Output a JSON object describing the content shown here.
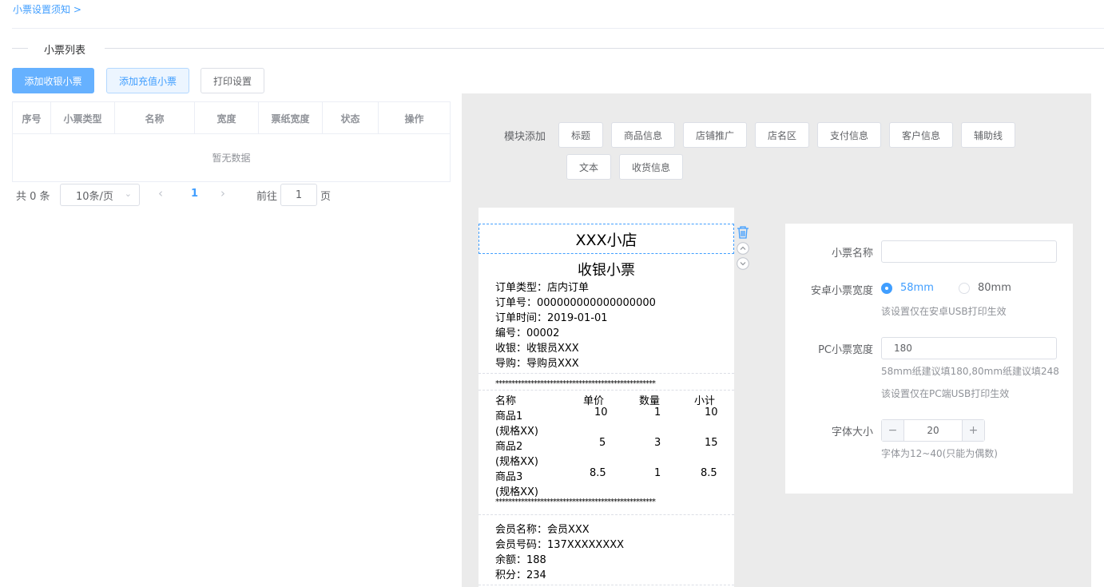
{
  "breadcrumb": "小票设置须知 >",
  "section_title": "小票列表",
  "buttons": {
    "add_cash": "添加收银小票",
    "add_recharge": "添加充值小票",
    "print_settings": "打印设置"
  },
  "table": {
    "columns": [
      "序号",
      "小票类型",
      "名称",
      "宽度",
      "票纸宽度",
      "状态",
      "操作"
    ],
    "empty_text": "暂无数据"
  },
  "pagination": {
    "total": "共 0 条",
    "page_size": "10条/页",
    "current_page": "1",
    "goto_label": "前往",
    "goto_value": "1",
    "page_suffix": "页"
  },
  "modules": {
    "label": "模块添加",
    "items": [
      "标题",
      "商品信息",
      "店铺推广",
      "店名区",
      "支付信息",
      "客户信息",
      "辅助线",
      "文本",
      "收货信息"
    ]
  },
  "receipt": {
    "shop_name": "XXX小店",
    "title": "收银小票",
    "info_lines": [
      "订单类型：店内订单",
      "订单号：000000000000000000",
      "订单时间：2019-01-01",
      "编号：00002",
      "收银：收银员XXX",
      "导购：导购员XXX"
    ],
    "stars": "**************************************************",
    "goods_header": [
      "名称",
      "单价",
      "数量",
      "小计"
    ],
    "goods": [
      {
        "name": "商品1",
        "spec": "(规格XX)",
        "price": "10",
        "qty": "1",
        "subtotal": "10"
      },
      {
        "name": "商品2",
        "spec": "(规格XX)",
        "price": "5",
        "qty": "3",
        "subtotal": "15"
      },
      {
        "name": "商品3",
        "spec": "(规格XX)",
        "price": "8.5",
        "qty": "1",
        "subtotal": "8.5"
      }
    ],
    "member_lines": [
      "会员名称：会员XXX",
      "会员号码：137XXXXXXXX",
      "余额：188",
      "积分：234"
    ]
  },
  "settings": {
    "name_label": "小票名称",
    "name_value": "",
    "android_width_label": "安卓小票宽度",
    "android_options": [
      "58mm",
      "80mm"
    ],
    "android_selected": "58mm",
    "android_hint": "该设置仅在安卓USB打印生效",
    "pc_width_label": "PC小票宽度",
    "pc_width_value": "180",
    "pc_hint1": "58mm纸建议填180,80mm纸建议填248",
    "pc_hint2": "该设置仅在PC端USB打印生效",
    "font_size_label": "字体大小",
    "font_size_value": "20",
    "font_hint": "字体为12~40(只能为偶数)"
  },
  "colors": {
    "primary": "#409eff",
    "primary_light": "#66b1ff",
    "editor_bg": "#ebebeb"
  }
}
